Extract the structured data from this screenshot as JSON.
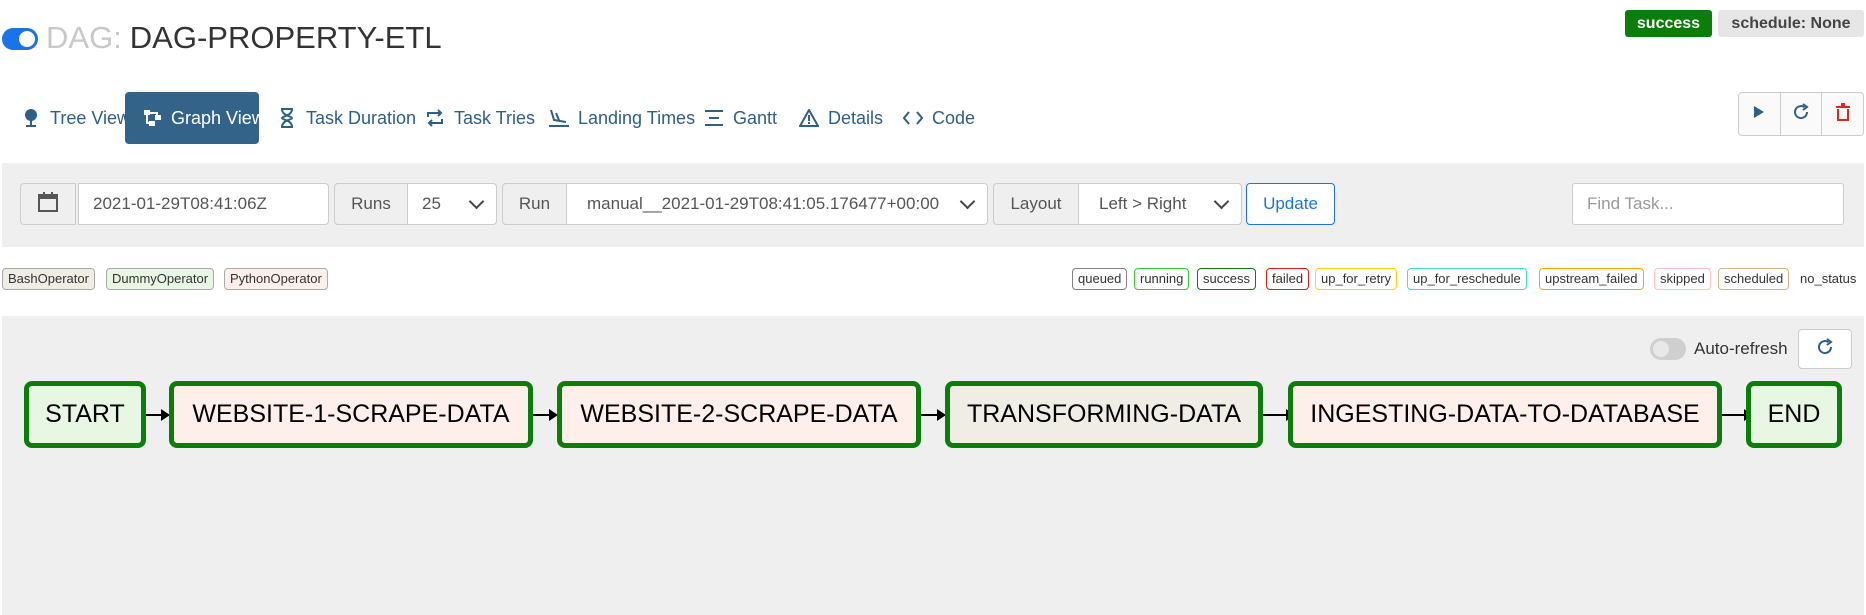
{
  "header": {
    "dag_prefix": "DAG:",
    "dag_name": "DAG-PROPERTY-ETL",
    "status_badge": "success",
    "schedule_badge": "schedule: None"
  },
  "tabs": [
    {
      "label": "Tree View",
      "icon": "map-pin-icon"
    },
    {
      "label": "Graph View",
      "icon": "graph-icon",
      "active": true
    },
    {
      "label": "Task Duration",
      "icon": "hourglass-icon"
    },
    {
      "label": "Task Tries",
      "icon": "retry-arrows-icon"
    },
    {
      "label": "Landing Times",
      "icon": "plane-landing-icon"
    },
    {
      "label": "Gantt",
      "icon": "gantt-icon"
    },
    {
      "label": "Details",
      "icon": "warning-triangle-icon"
    },
    {
      "label": "Code",
      "icon": "code-icon"
    }
  ],
  "actions": [
    "play-icon",
    "refresh-icon",
    "trash-icon"
  ],
  "filters": {
    "date_value": "2021-01-29T08:41:06Z",
    "runs_label": "Runs",
    "runs_value": "25",
    "run_label": "Run",
    "run_value": "manual__2021-01-29T08:41:05.176477+00:00",
    "layout_label": "Layout",
    "layout_value": "Left > Right",
    "update_label": "Update",
    "find_placeholder": "Find Task..."
  },
  "operators": [
    "BashOperator",
    "DummyOperator",
    "PythonOperator"
  ],
  "states": [
    "queued",
    "running",
    "success",
    "failed",
    "up_for_retry",
    "up_for_reschedule",
    "upstream_failed",
    "skipped",
    "scheduled",
    "no_status"
  ],
  "graph": {
    "auto_refresh_label": "Auto-refresh",
    "nodes": [
      "START",
      "WEBSITE-1-SCRAPE-DATA",
      "WEBSITE-2-SCRAPE-DATA",
      "TRANSFORMING-DATA",
      "INGESTING-DATA-TO-DATABASE",
      "END"
    ]
  },
  "colors": {
    "success": "#0a7d0a",
    "tab_active": "#34638a",
    "link": "#2e5f86",
    "node_border": "#0a7d0a",
    "dummy_fill": "#e8f7e4",
    "python_fill": "#ffefeb",
    "bash_fill": "#f0ede4"
  }
}
